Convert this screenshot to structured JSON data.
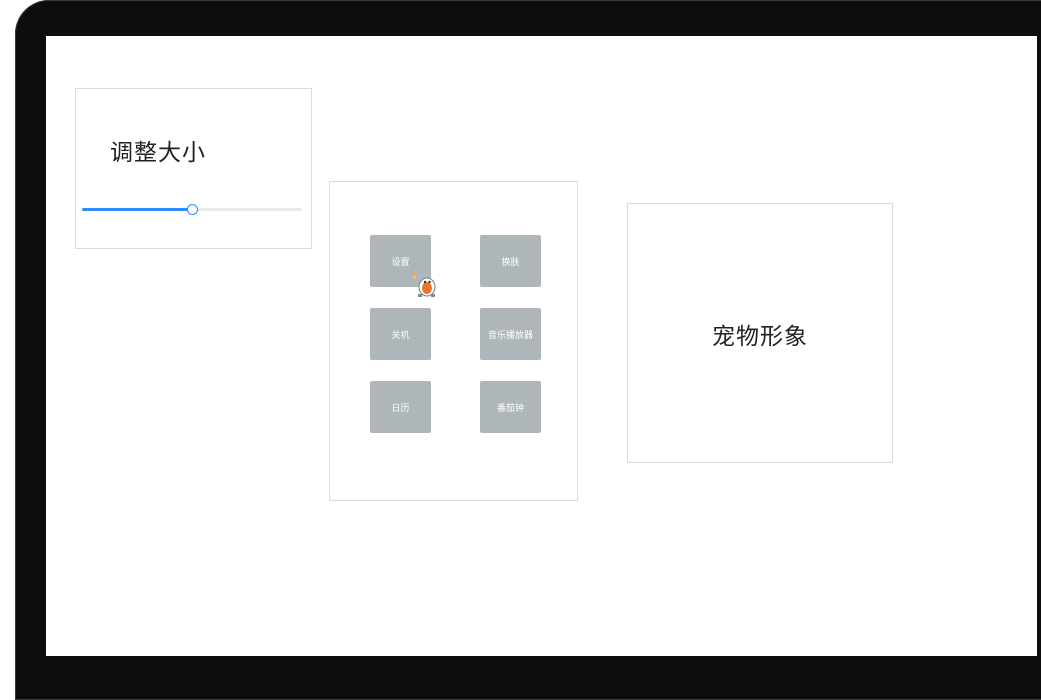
{
  "resize": {
    "title": "调整大小",
    "slider_value_fraction": 0.5,
    "accent_color": "#2e8bff"
  },
  "menu": {
    "buttons": [
      {
        "label": "设置"
      },
      {
        "label": "换肤"
      },
      {
        "label": "关机"
      },
      {
        "label": "音乐播放器"
      },
      {
        "label": "日历"
      },
      {
        "label": "番茄钟"
      }
    ],
    "button_color": "#aeb6ba",
    "cursor_icon": "pet-sprite-icon"
  },
  "pet": {
    "label": "宠物形象"
  }
}
